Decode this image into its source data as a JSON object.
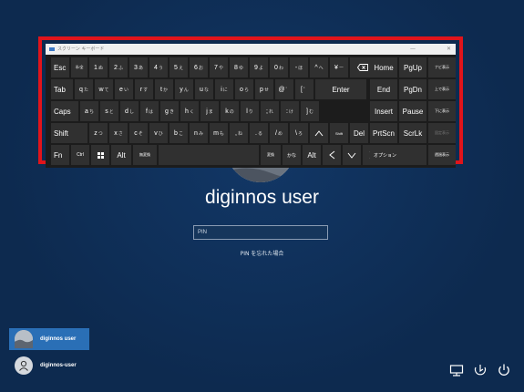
{
  "osk": {
    "title": "スクリーン キーボード",
    "minimize": "—",
    "close": "✕",
    "rows": [
      [
        {
          "label": "Esc",
          "cls": "left"
        },
        {
          "label": "半/全",
          "cls": "tiny"
        },
        {
          "main": "1",
          "sub": "ぬ"
        },
        {
          "main": "2",
          "sub": "ふ"
        },
        {
          "main": "3",
          "sub": "あ"
        },
        {
          "main": "4",
          "sub": "う"
        },
        {
          "main": "5",
          "sub": "え"
        },
        {
          "main": "6",
          "sub": "お"
        },
        {
          "main": "7",
          "sub": "や"
        },
        {
          "main": "8",
          "sub": "ゆ"
        },
        {
          "main": "9",
          "sub": "よ"
        },
        {
          "main": "0",
          "sub": "わ"
        },
        {
          "main": "-",
          "sub": "ほ"
        },
        {
          "main": "^",
          "sub": "へ"
        },
        {
          "main": "¥",
          "sub": "ー"
        },
        {
          "icon": "backspace-icon"
        }
      ],
      [
        {
          "label": "Tab",
          "cls": "left"
        },
        {
          "main": "q",
          "sub": "た"
        },
        {
          "main": "w",
          "sub": "て"
        },
        {
          "main": "e",
          "sub": "い"
        },
        {
          "main": "r",
          "sub": "す"
        },
        {
          "main": "t",
          "sub": "か"
        },
        {
          "main": "y",
          "sub": "ん"
        },
        {
          "main": "u",
          "sub": "な"
        },
        {
          "main": "i",
          "sub": "に"
        },
        {
          "main": "o",
          "sub": "ら"
        },
        {
          "main": "p",
          "sub": "せ"
        },
        {
          "main": "@",
          "sub": "゛"
        },
        {
          "main": "[",
          "sub": "゜"
        },
        {
          "label": "Enter"
        }
      ],
      [
        {
          "label": "Caps",
          "cls": "left"
        },
        {
          "main": "a",
          "sub": "ち"
        },
        {
          "main": "s",
          "sub": "と"
        },
        {
          "main": "d",
          "sub": "し"
        },
        {
          "main": "f",
          "sub": "は"
        },
        {
          "main": "g",
          "sub": "き"
        },
        {
          "main": "h",
          "sub": "く"
        },
        {
          "main": "j",
          "sub": "ま"
        },
        {
          "main": "k",
          "sub": "の"
        },
        {
          "main": "l",
          "sub": "り"
        },
        {
          "main": ";",
          "sub": "れ"
        },
        {
          "main": ":",
          "sub": "け"
        },
        {
          "main": "]",
          "sub": "む"
        }
      ],
      [
        {
          "label": "Shift",
          "cls": "left"
        },
        {
          "main": "z",
          "sub": "つ"
        },
        {
          "main": "x",
          "sub": "さ"
        },
        {
          "main": "c",
          "sub": "そ"
        },
        {
          "main": "v",
          "sub": "ひ"
        },
        {
          "main": "b",
          "sub": "こ"
        },
        {
          "main": "n",
          "sub": "み"
        },
        {
          "main": "m",
          "sub": "も"
        },
        {
          "main": ",",
          "sub": "ね"
        },
        {
          "main": ".",
          "sub": "る"
        },
        {
          "main": "/",
          "sub": "め"
        },
        {
          "main": "\\",
          "sub": "ろ"
        },
        {
          "icon": "arrow-up-icon"
        },
        {
          "label": "Shift",
          "cls": "tiny"
        },
        {
          "label": "Del"
        }
      ],
      [
        {
          "label": "Fn",
          "cls": "left"
        },
        {
          "label": "Ctrl",
          "cls": "small"
        },
        {
          "icon": "windows-icon"
        },
        {
          "label": "Alt"
        },
        {
          "label": "無変換",
          "cls": "tiny"
        },
        {
          "label": ""
        },
        {
          "label": "変換",
          "cls": "tiny"
        },
        {
          "label": "かな",
          "cls": "small"
        },
        {
          "label": "Alt"
        },
        {
          "icon": "arrow-left-icon"
        },
        {
          "icon": "arrow-down-icon"
        },
        {
          "icon": "arrow-right-icon"
        },
        {
          "icon": "menu-icon"
        }
      ]
    ],
    "nav": [
      [
        "Home",
        "PgUp",
        "ナビ表示"
      ],
      [
        "End",
        "PgDn",
        "上で表示"
      ],
      [
        "Insert",
        "Pause",
        "下に表示"
      ],
      [
        "PrtScn",
        "ScrLk",
        "固定表示"
      ],
      [
        "オプション",
        "",
        "透過表示"
      ]
    ]
  },
  "login": {
    "username": "diginnos user",
    "pin_placeholder": "PIN",
    "forgot_pin": "PIN を忘れた場合"
  },
  "users": [
    {
      "name": "diginnos user",
      "selected": true
    },
    {
      "name": "diginnos-user",
      "selected": false
    }
  ],
  "system_icons": [
    "network-icon",
    "ease-of-access-icon",
    "power-icon"
  ]
}
